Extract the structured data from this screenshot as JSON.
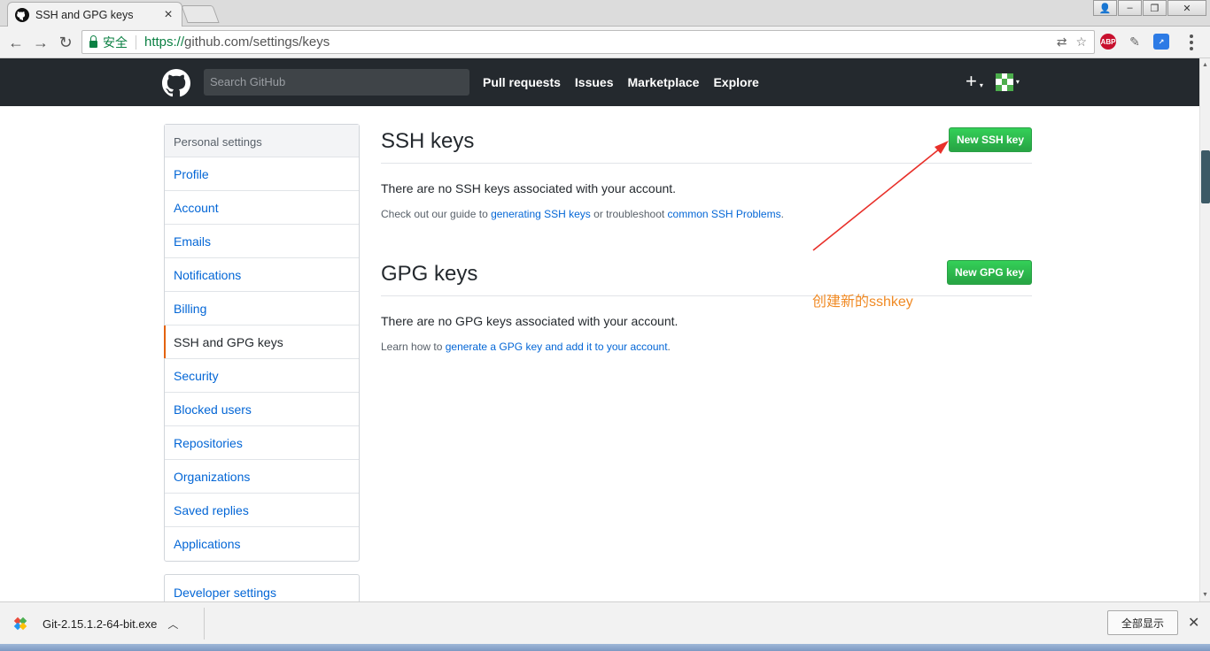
{
  "browser": {
    "tab_title": "SSH and GPG keys",
    "tab_close": "×",
    "window_buttons": [
      "👤",
      "–",
      "❐",
      "✕"
    ],
    "secure_label": "安全",
    "url_scheme": "https://",
    "url_rest": "github.com/settings/keys",
    "extensions": [
      {
        "name": "ABP",
        "color": "#c8102e"
      },
      {
        "name": "",
        "color": "#777777"
      },
      {
        "name": "",
        "color": "#2d7be5"
      }
    ]
  },
  "github": {
    "search_placeholder": "Search GitHub",
    "nav": [
      "Pull requests",
      "Issues",
      "Marketplace",
      "Explore"
    ],
    "plus": "+",
    "caret": "▾"
  },
  "sidebar": {
    "header": "Personal settings",
    "items": [
      {
        "label": "Profile"
      },
      {
        "label": "Account"
      },
      {
        "label": "Emails"
      },
      {
        "label": "Notifications"
      },
      {
        "label": "Billing"
      },
      {
        "label": "SSH and GPG keys"
      },
      {
        "label": "Security"
      },
      {
        "label": "Blocked users"
      },
      {
        "label": "Repositories"
      },
      {
        "label": "Organizations"
      },
      {
        "label": "Saved replies"
      },
      {
        "label": "Applications"
      }
    ],
    "developer_settings": "Developer settings"
  },
  "ssh": {
    "title": "SSH keys",
    "button": "New SSH key",
    "empty_message": "There are no SSH keys associated with your account.",
    "note_prefix": "Check out our guide to ",
    "note_link1": "generating SSH keys",
    "note_middle": " or troubleshoot ",
    "note_link2": "common SSH Problems",
    "note_suffix": "."
  },
  "gpg": {
    "title": "GPG keys",
    "button": "New GPG key",
    "empty_message": "There are no GPG keys associated with your account.",
    "note_prefix": "Learn how to ",
    "note_link": "generate a GPG key and add it to your account",
    "note_suffix": "."
  },
  "annotation": {
    "text": "创建新的sshkey",
    "color": "#f08a24"
  },
  "download_bar": {
    "filename": "Git-2.15.1.2-64-bit.exe",
    "show_all": "全部显示",
    "close": "✕"
  }
}
